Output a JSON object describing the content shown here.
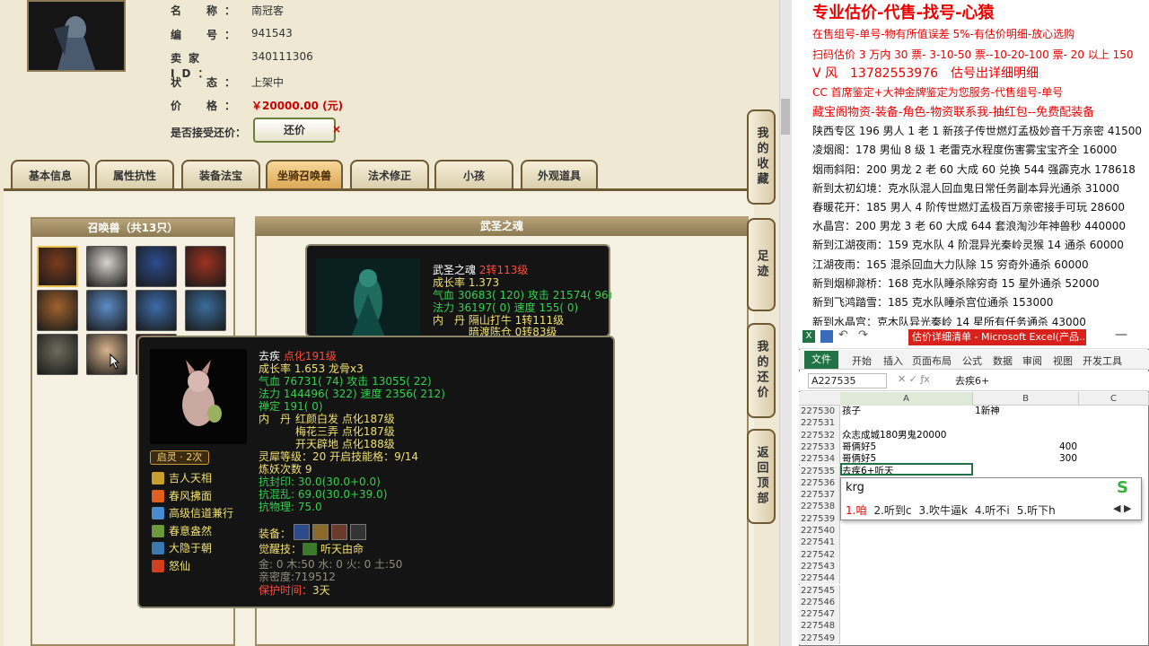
{
  "account": {
    "rows": [
      {
        "key": "名　称：",
        "value": "南冠客"
      },
      {
        "key": "编　号：",
        "value": "941543"
      },
      {
        "key": "卖家 ID：",
        "value": "340111306"
      },
      {
        "key": "状　态：",
        "value": "上架中"
      },
      {
        "key": "价　格：",
        "value": "￥20000.00 (元)"
      }
    ],
    "bargain_label": "是否接受还价：",
    "bargain_button": "还价",
    "bargain_x": "×"
  },
  "tabs": [
    "基本信息",
    "属性抗性",
    "装备法宝",
    "坐骑召唤兽",
    "法术修正",
    "小孩",
    "外观道具"
  ],
  "active_tab": 3,
  "pets": {
    "header": "召唤兽（共13只）",
    "colors": [
      "#7a3b1c",
      "#d8d4cc",
      "#2c4c8c",
      "#9c3220",
      "#a0622c",
      "#5c8cc8",
      "#3c6ca8",
      "#3a6c9a",
      "#6c6c5c",
      "#d9b48c",
      "#8c2c1c"
    ]
  },
  "detail_header": "武圣之魂",
  "tooltip_back": {
    "name": "武圣之魂",
    "level": "2转113级",
    "growth": "成长率 1.373",
    "hp": "气血 30683( 120) 攻击 21574( 96)",
    "mp": "法力 36197( 0) 速度 155( 0)",
    "neidan1": "内　丹 隔山打牛 1转111级",
    "neidan2": "　　　 暗渡陈仓 0转83级"
  },
  "tooltip_front": {
    "name": "去疾",
    "level": "点化191级",
    "growth": "成长率 1.653 龙骨x3",
    "hp": "气血 76731( 74) 攻击 13055( 22)",
    "mp": "法力 144496( 322) 速度 2356( 212)",
    "chanding": "禅定 191( 0)",
    "neidan_label": "内　丹",
    "neidan": [
      "红颜白发 点化187级",
      "梅花三弄 点化187级",
      "开天辟地 点化188级"
    ],
    "qiling_badge": "启灵 · 2次",
    "skills": [
      "吉人天相",
      "春风拂面",
      "高级信道兼行",
      "春意盎然",
      "大隐于朝",
      "怒仙"
    ],
    "lingxi": "灵犀等级：20 开启技能格：9/14",
    "lianyao": "炼妖次数 9",
    "kangfengyin": "抗封印: 30.0(30.0+0.0)",
    "kanghunluan": "抗混乱: 69.0(30.0+39.0)",
    "kangwuli": "抗物理: 75.0",
    "equip_label": "装备：",
    "juexing_label": "觉醒技：",
    "juexing": "听天由命",
    "wuxing": "金: 0 木:50 水: 0 火: 0 土:50",
    "qinmi": "亲密度:719512",
    "protect_label": "保护时间：",
    "protect_value": "3天"
  },
  "side_buttons": [
    "我的收藏",
    "足迹",
    "我的还价",
    "返回顶部"
  ],
  "doc_lines": [
    {
      "text": "专业估价-代售-找号-心猿",
      "color": "red",
      "size": 18
    },
    {
      "text": "在售组号-单号-物有所值误差 5%-有估价明细-放心选购",
      "color": "red",
      "size": 12
    },
    {
      "text": "扫码估价 3 万内 30 票- 3-10-50 票--10-20-100 票- 20 以上 150",
      "color": "red",
      "size": 12
    },
    {
      "text": "V 风　13782553976　估号出详细明细",
      "color": "red",
      "size": 14
    },
    {
      "text": "CC 首席鉴定+大神金牌鉴定为您服务-代售组号-单号",
      "color": "red",
      "size": 12
    },
    {
      "text": "藏宝阁物资-装备-角色-物资联系我-抽红包--免费配装备",
      "color": "red",
      "size": 13
    },
    {
      "text": "陕西专区 196 男人 1 老 1 新孩子传世燃灯孟极妙音千万亲密 41500",
      "color": "black",
      "size": 12
    },
    {
      "text": "凌烟阁：178 男仙 8 级 1 老雷克水程度伤害雾宝宝齐全 16000",
      "color": "black",
      "size": 12
    },
    {
      "text": "烟雨斜阳：200 男龙 2 老 60 大成 60 兑换 544 强霹克水 178618",
      "color": "black",
      "size": 12
    },
    {
      "text": "新到太初幻境：克水队混人回血鬼日常任务副本异光通杀 31000",
      "color": "black",
      "size": 12
    },
    {
      "text": "春暖花开：185 男人 4 阶传世燃灯孟极百万亲密接手可玩 28600",
      "color": "black",
      "size": 12
    },
    {
      "text": "水晶宫：200 男龙 3 老 60 大成 644 套浪淘沙年神兽秒 440000",
      "color": "black",
      "size": 12
    },
    {
      "text": "新到江湖夜雨：159 克水队 4 阶混异光秦岭灵猴 14 通杀 60000",
      "color": "black",
      "size": 12
    },
    {
      "text": "江湖夜雨：165 混杀回血大力队除 15 穷奇外通杀 60000",
      "color": "black",
      "size": 12
    },
    {
      "text": "新到烟柳滁桥：168 克水队睡杀除穷奇 15 星外通杀 52000",
      "color": "black",
      "size": 12
    },
    {
      "text": "新到飞鸿踏雪：185 克水队睡杀宫位通杀 153000",
      "color": "black",
      "size": 12
    },
    {
      "text": "新到水晶宫：克木队异光秦岭 14 星所有任务通杀 43000",
      "color": "black",
      "size": 12
    }
  ],
  "excel": {
    "title": "估价详细清单 - Microsoft Excel(产品...",
    "ribbon": [
      "文件",
      "开始",
      "插入",
      "页面布局",
      "公式",
      "数据",
      "审阅",
      "视图",
      "开发工具"
    ],
    "namebox": "A227535",
    "formula": "去疾6+",
    "columns": [
      "A",
      "B",
      "C"
    ],
    "rows": [
      {
        "n": "227530",
        "a": "孩子",
        "b": "1新神",
        "bright": false
      },
      {
        "n": "227531",
        "a": "",
        "b": "",
        "bright": false
      },
      {
        "n": "227532",
        "a": "众志成城180男鬼20000",
        "b": "",
        "bright": false
      },
      {
        "n": "227533",
        "a": "哥俩好5",
        "b": "400",
        "bright": true
      },
      {
        "n": "227534",
        "a": "哥俩好5",
        "b": "300",
        "bright": true
      },
      {
        "n": "227535",
        "a": "去疾6+听天",
        "b": "",
        "bright": false
      },
      {
        "n": "227536",
        "a": "",
        "b": "",
        "bright": false
      },
      {
        "n": "227537",
        "a": "",
        "b": "",
        "bright": false
      },
      {
        "n": "227538",
        "a": "",
        "b": "",
        "bright": false
      },
      {
        "n": "227539",
        "a": "",
        "b": "",
        "bright": false
      },
      {
        "n": "227540",
        "a": "",
        "b": "",
        "bright": false
      },
      {
        "n": "227541",
        "a": "",
        "b": "",
        "bright": false
      },
      {
        "n": "227542",
        "a": "",
        "b": "",
        "bright": false
      },
      {
        "n": "227543",
        "a": "",
        "b": "",
        "bright": false
      },
      {
        "n": "227544",
        "a": "",
        "b": "",
        "bright": false
      },
      {
        "n": "227545",
        "a": "",
        "b": "",
        "bright": false
      },
      {
        "n": "227546",
        "a": "",
        "b": "",
        "bright": false
      },
      {
        "n": "227547",
        "a": "",
        "b": "",
        "bright": false
      },
      {
        "n": "227548",
        "a": "",
        "b": "",
        "bright": false
      },
      {
        "n": "227549",
        "a": "",
        "b": "",
        "bright": false
      }
    ],
    "ime_input": "krg",
    "ime_candidates": [
      "1.咱",
      "2.听到c",
      "3.吹牛逼k",
      "4.听不i",
      "5.听下h"
    ]
  }
}
